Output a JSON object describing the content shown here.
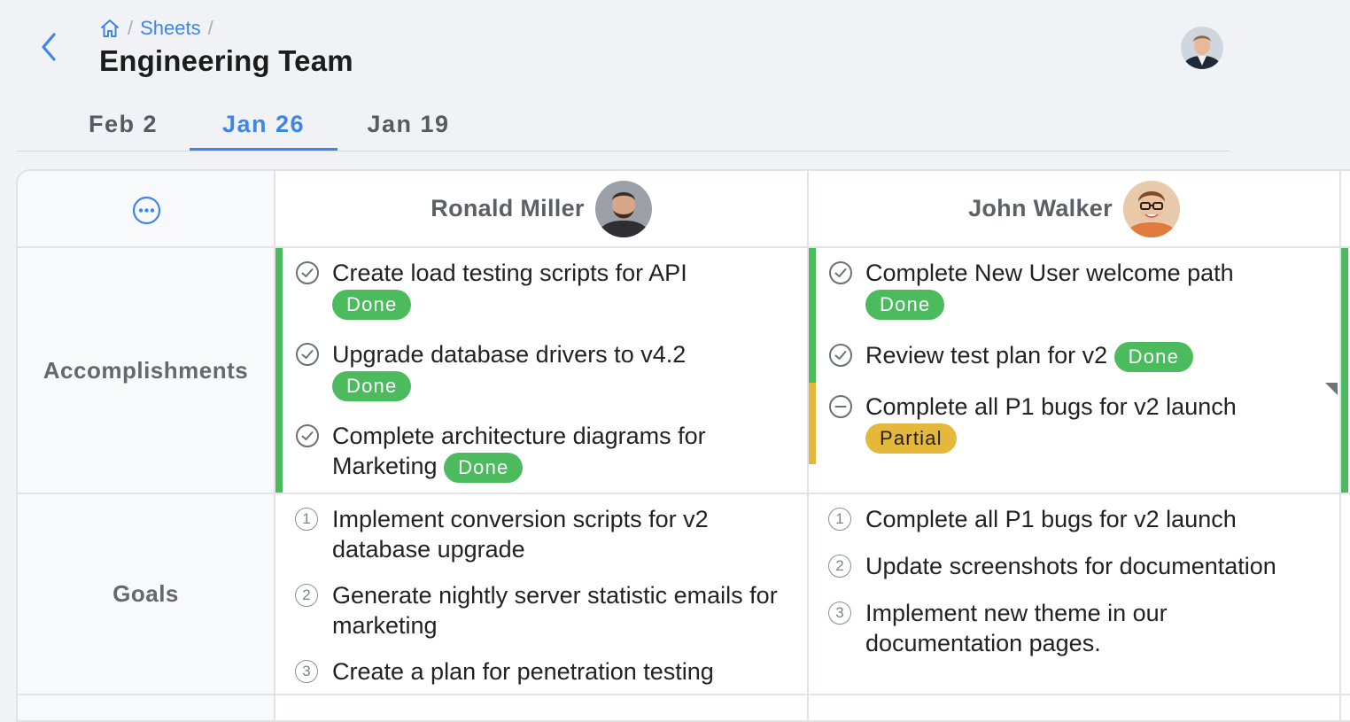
{
  "breadcrumb": {
    "home_icon": "home-icon",
    "sheets": "Sheets",
    "separator": "/"
  },
  "page_title": "Engineering Team",
  "tabs": [
    {
      "label": "Feb 2",
      "active": false
    },
    {
      "label": "Jan 26",
      "active": true
    },
    {
      "label": "Jan 19",
      "active": false
    }
  ],
  "table": {
    "people": [
      {
        "name": "Ronald Miller"
      },
      {
        "name": "John Walker"
      }
    ],
    "rows": {
      "accomplishments": "Accomplishments",
      "goals": "Goals"
    },
    "ronald": {
      "accomplishments": [
        {
          "text": "Create load testing scripts for API",
          "status": "Done"
        },
        {
          "text": "Upgrade database drivers to v4.2",
          "status": "Done"
        },
        {
          "text": "Complete architecture diagrams for Marketing",
          "status": "Done"
        }
      ],
      "goals": [
        {
          "num": "1",
          "text": "Implement conversion scripts for v2 database upgrade"
        },
        {
          "num": "2",
          "text": "Generate nightly server statistic emails for marketing"
        },
        {
          "num": "3",
          "text": "Create a plan for penetration testing"
        }
      ]
    },
    "john": {
      "accomplishments": [
        {
          "text": "Complete New User welcome path",
          "status": "Done"
        },
        {
          "text": "Review test plan for v2",
          "status": "Done"
        },
        {
          "text": "Complete all P1 bugs for v2 launch",
          "status": "Partial"
        }
      ],
      "goals": [
        {
          "num": "1",
          "text": "Complete all P1 bugs for v2 launch"
        },
        {
          "num": "2",
          "text": "Update screenshots for documentation"
        },
        {
          "num": "3",
          "text": "Implement new theme in our documentation pages."
        }
      ]
    }
  },
  "colors": {
    "accent": "#3d86e8",
    "done": "#4cbb5d",
    "partial": "#e5b83c"
  }
}
